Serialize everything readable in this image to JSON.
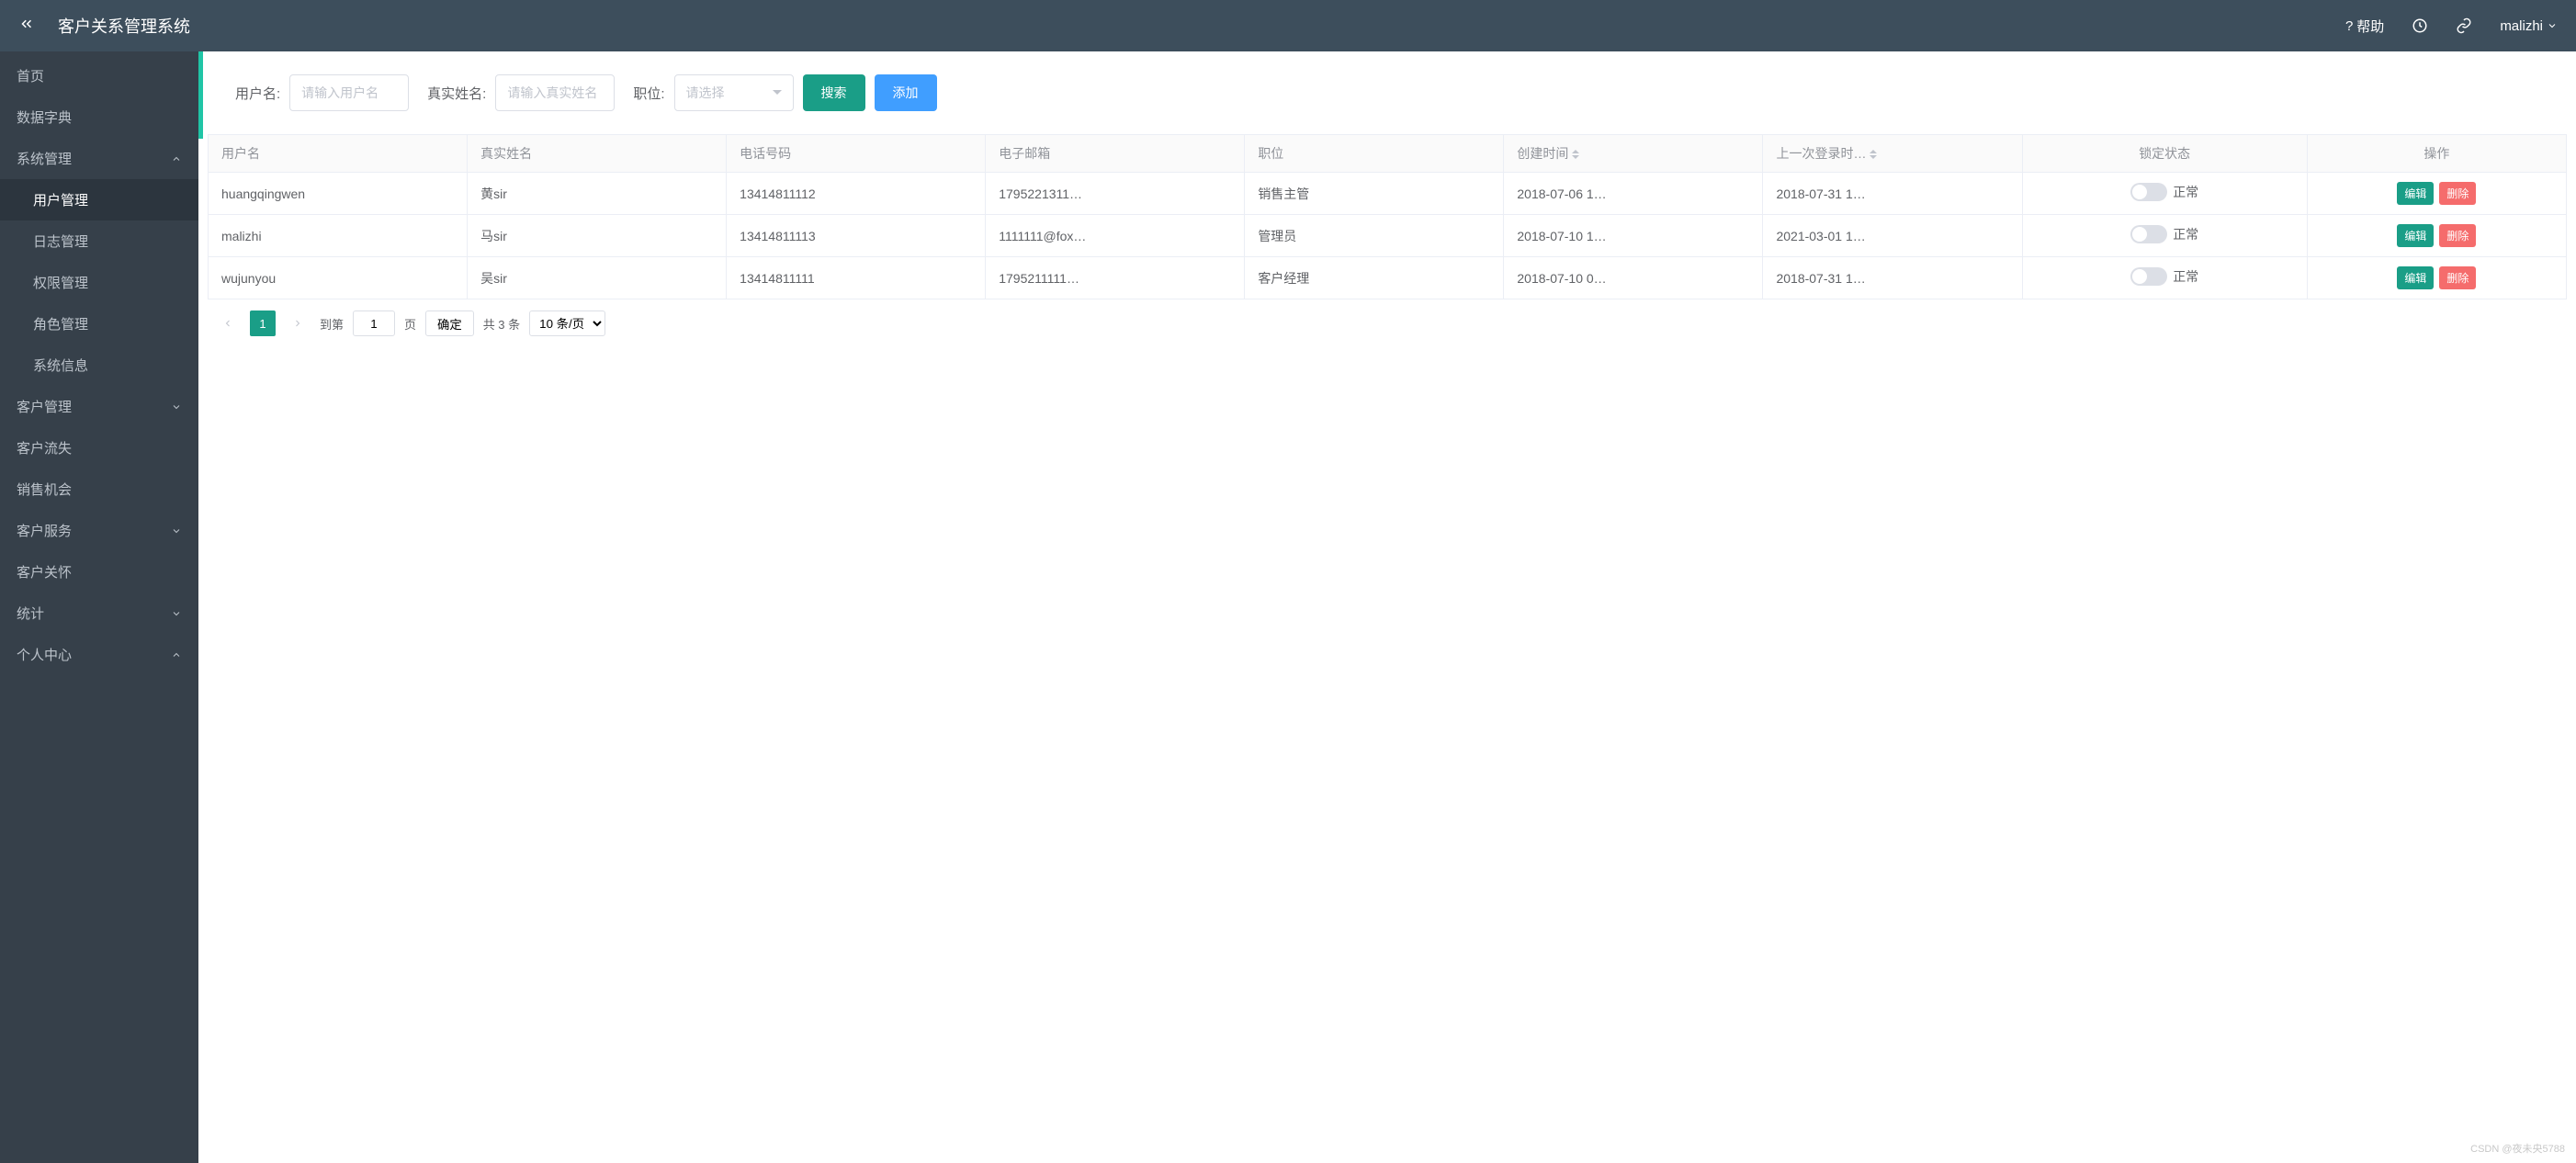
{
  "header": {
    "title": "客户关系管理系统",
    "help_label": "帮助",
    "username": "malizhi"
  },
  "sidebar": {
    "items": [
      {
        "label": "首页",
        "expandable": false
      },
      {
        "label": "数据字典",
        "expandable": false
      },
      {
        "label": "系统管理",
        "expandable": true,
        "expanded": true,
        "children": [
          {
            "label": "用户管理",
            "active": true
          },
          {
            "label": "日志管理"
          },
          {
            "label": "权限管理"
          },
          {
            "label": "角色管理"
          },
          {
            "label": "系统信息"
          }
        ]
      },
      {
        "label": "客户管理",
        "expandable": true,
        "expanded": false
      },
      {
        "label": "客户流失",
        "expandable": false
      },
      {
        "label": "销售机会",
        "expandable": false
      },
      {
        "label": "客户服务",
        "expandable": true,
        "expanded": false
      },
      {
        "label": "客户关怀",
        "expandable": false
      },
      {
        "label": "统计",
        "expandable": true,
        "expanded": false
      },
      {
        "label": "个人中心",
        "expandable": true,
        "expanded": true
      }
    ]
  },
  "search": {
    "username_label": "用户名:",
    "username_placeholder": "请输入用户名",
    "realname_label": "真实姓名:",
    "realname_placeholder": "请输入真实姓名",
    "position_label": "职位:",
    "position_placeholder": "请选择",
    "search_btn": "搜索",
    "add_btn": "添加"
  },
  "table": {
    "headers": {
      "username": "用户名",
      "realname": "真实姓名",
      "phone": "电话号码",
      "email": "电子邮箱",
      "position": "职位",
      "createtime": "创建时间",
      "lastlogin": "上一次登录时…",
      "lockstatus": "锁定状态",
      "actions": "操作"
    },
    "rows": [
      {
        "username": "huangqingwen",
        "realname": "黄sir",
        "phone": "13414811112",
        "email": "1795221311…",
        "position": "销售主管",
        "createtime": "2018-07-06 1…",
        "lastlogin": "2018-07-31 1…",
        "lockstatus": "正常"
      },
      {
        "username": "malizhi",
        "realname": "马sir",
        "phone": "13414811113",
        "email": "1111111@fox…",
        "position": "管理员",
        "createtime": "2018-07-10 1…",
        "lastlogin": "2021-03-01 1…",
        "lockstatus": "正常"
      },
      {
        "username": "wujunyou",
        "realname": "吴sir",
        "phone": "13414811111",
        "email": "1795211111…",
        "position": "客户经理",
        "createtime": "2018-07-10 0…",
        "lastlogin": "2018-07-31 1…",
        "lockstatus": "正常"
      }
    ],
    "edit_btn": "编辑",
    "delete_btn": "删除"
  },
  "pagination": {
    "current": "1",
    "jump_prefix": "到第",
    "jump_value": "1",
    "jump_suffix": "页",
    "confirm": "确定",
    "total": "共 3 条",
    "per_page": "10 条/页"
  },
  "watermark": "CSDN @夜未央5788"
}
